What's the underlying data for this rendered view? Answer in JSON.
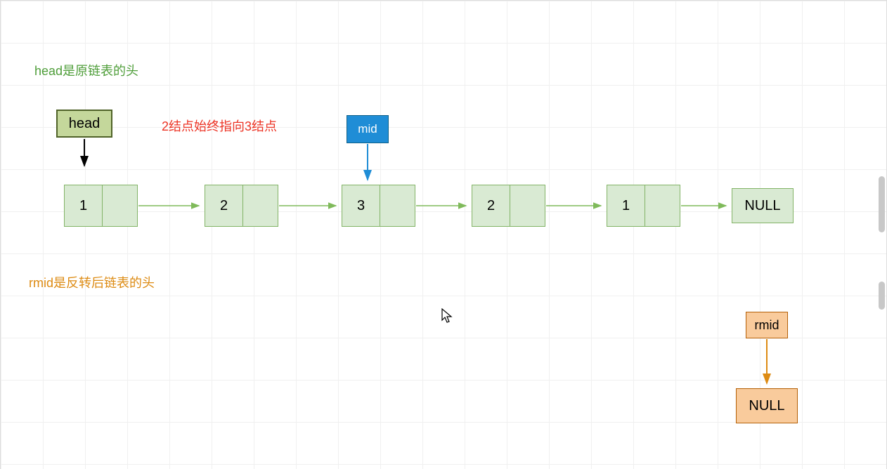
{
  "labels": {
    "head_desc": "head是原链表的头",
    "red_note": "2结点始终指向3结点",
    "rmid_desc": "rmid是反转后链表的头"
  },
  "colors": {
    "green_text": "#4f9e3a",
    "red_text": "#ec3324",
    "orange_text": "#dd8b13",
    "node_fill": "#d9ead3",
    "node_border": "#82b366",
    "head_fill": "#c4d79b",
    "head_border": "#4f6228",
    "mid_fill": "#1f8dd6",
    "rmid_fill": "#f9cb9c",
    "arrow_green": "#7fba5a",
    "arrow_blue": "#1f8dd6",
    "arrow_orange": "#dd8b13",
    "arrow_black": "#000000"
  },
  "pointers": {
    "head": "head",
    "mid": "mid",
    "rmid": "rmid"
  },
  "nodes": [
    {
      "value": "1"
    },
    {
      "value": "2"
    },
    {
      "value": "3"
    },
    {
      "value": "2"
    },
    {
      "value": "1"
    }
  ],
  "null_labels": {
    "green": "NULL",
    "orange": "NULL"
  },
  "chart_data": {
    "type": "diagram",
    "description": "Linked list palindrome check diagram",
    "linked_list": [
      "1",
      "2",
      "3",
      "2",
      "1",
      "NULL"
    ],
    "pointers": {
      "head": {
        "points_to": "node index 0 (value 1)",
        "label": "head"
      },
      "mid": {
        "points_to": "node index 2 (value 3)",
        "label": "mid"
      },
      "rmid": {
        "points_to": "NULL (reversed list head, initially empty)",
        "label": "rmid"
      }
    },
    "annotations": [
      {
        "text": "head是原链表的头",
        "color": "green"
      },
      {
        "text": "2结点始终指向3结点",
        "color": "red"
      },
      {
        "text": "rmid是反转后链表的头",
        "color": "orange"
      }
    ]
  }
}
